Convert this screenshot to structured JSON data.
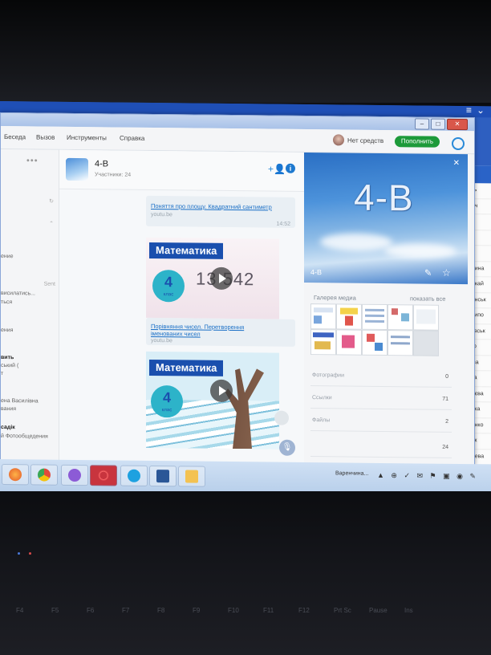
{
  "app": {
    "menu": [
      "Беседа",
      "Вызов",
      "Инструменты",
      "Справка"
    ],
    "account_status": "Нет средств",
    "topup_label": "Пополнить"
  },
  "left_panel": {
    "items": [
      "ение",
      "Sent",
      "висилатись...",
      "ться",
      "ения",
      "вить",
      "ський (",
      "т",
      "ена Василівна",
      "вания",
      "садік",
      "й Фотообщедения"
    ]
  },
  "conversation": {
    "title": "4-В",
    "subtitle": "Участники: 24",
    "messages": [
      {
        "link": "Поняття про площу. Квадратний сантиметр",
        "source": "youtu.be",
        "time": "14:52"
      },
      {
        "link": "Порівняння чисел. Перетворення іменованих чисел",
        "source": "youtu.be",
        "time": ""
      }
    ],
    "video_cards": [
      {
        "banner": "Математика",
        "grade": "4",
        "grade_word": "клас",
        "number": "13 542"
      },
      {
        "banner": "Математика",
        "grade": "4",
        "grade_word": "клас"
      }
    ]
  },
  "profile": {
    "title": "4-В",
    "name": "4-В",
    "gallery_label": "Галерея медиа",
    "gallery_all": "показать все",
    "stats": [
      {
        "label": "Фотографии",
        "value": "0"
      },
      {
        "label": "Ссылки",
        "value": "71"
      },
      {
        "label": "Файлы",
        "value": "2"
      },
      {
        "label": "",
        "value": "24"
      }
    ]
  },
  "background_window": {
    "rows": [
      "инець",
      "Оверч",
      "Ірлик",
      "Рнич",
      "Фічук",
      "Поблина",
      "Поцикай",
      "Полянськ",
      "Верлипо",
      "Талевськ",
      "ленко",
      "ганова",
      "ганіна",
      "Вергієва",
      "Ієвська",
      "Савенко",
      "Фішик",
      "Полиева",
      "Поновм"
    ]
  },
  "taskbar": {
    "tray_label": "Варенчина..."
  },
  "keyboard": {
    "keys": [
      "F4",
      "F5",
      "F6",
      "F7",
      "F8",
      "F9",
      "F10",
      "F11",
      "F12",
      "Prt Sc",
      "Pause",
      "Ins"
    ]
  },
  "colors": {
    "accent": "#2a8ad8",
    "topup": "#1d9a3a",
    "banner": "#1a4fae",
    "desktop": "#2e5fc0"
  }
}
